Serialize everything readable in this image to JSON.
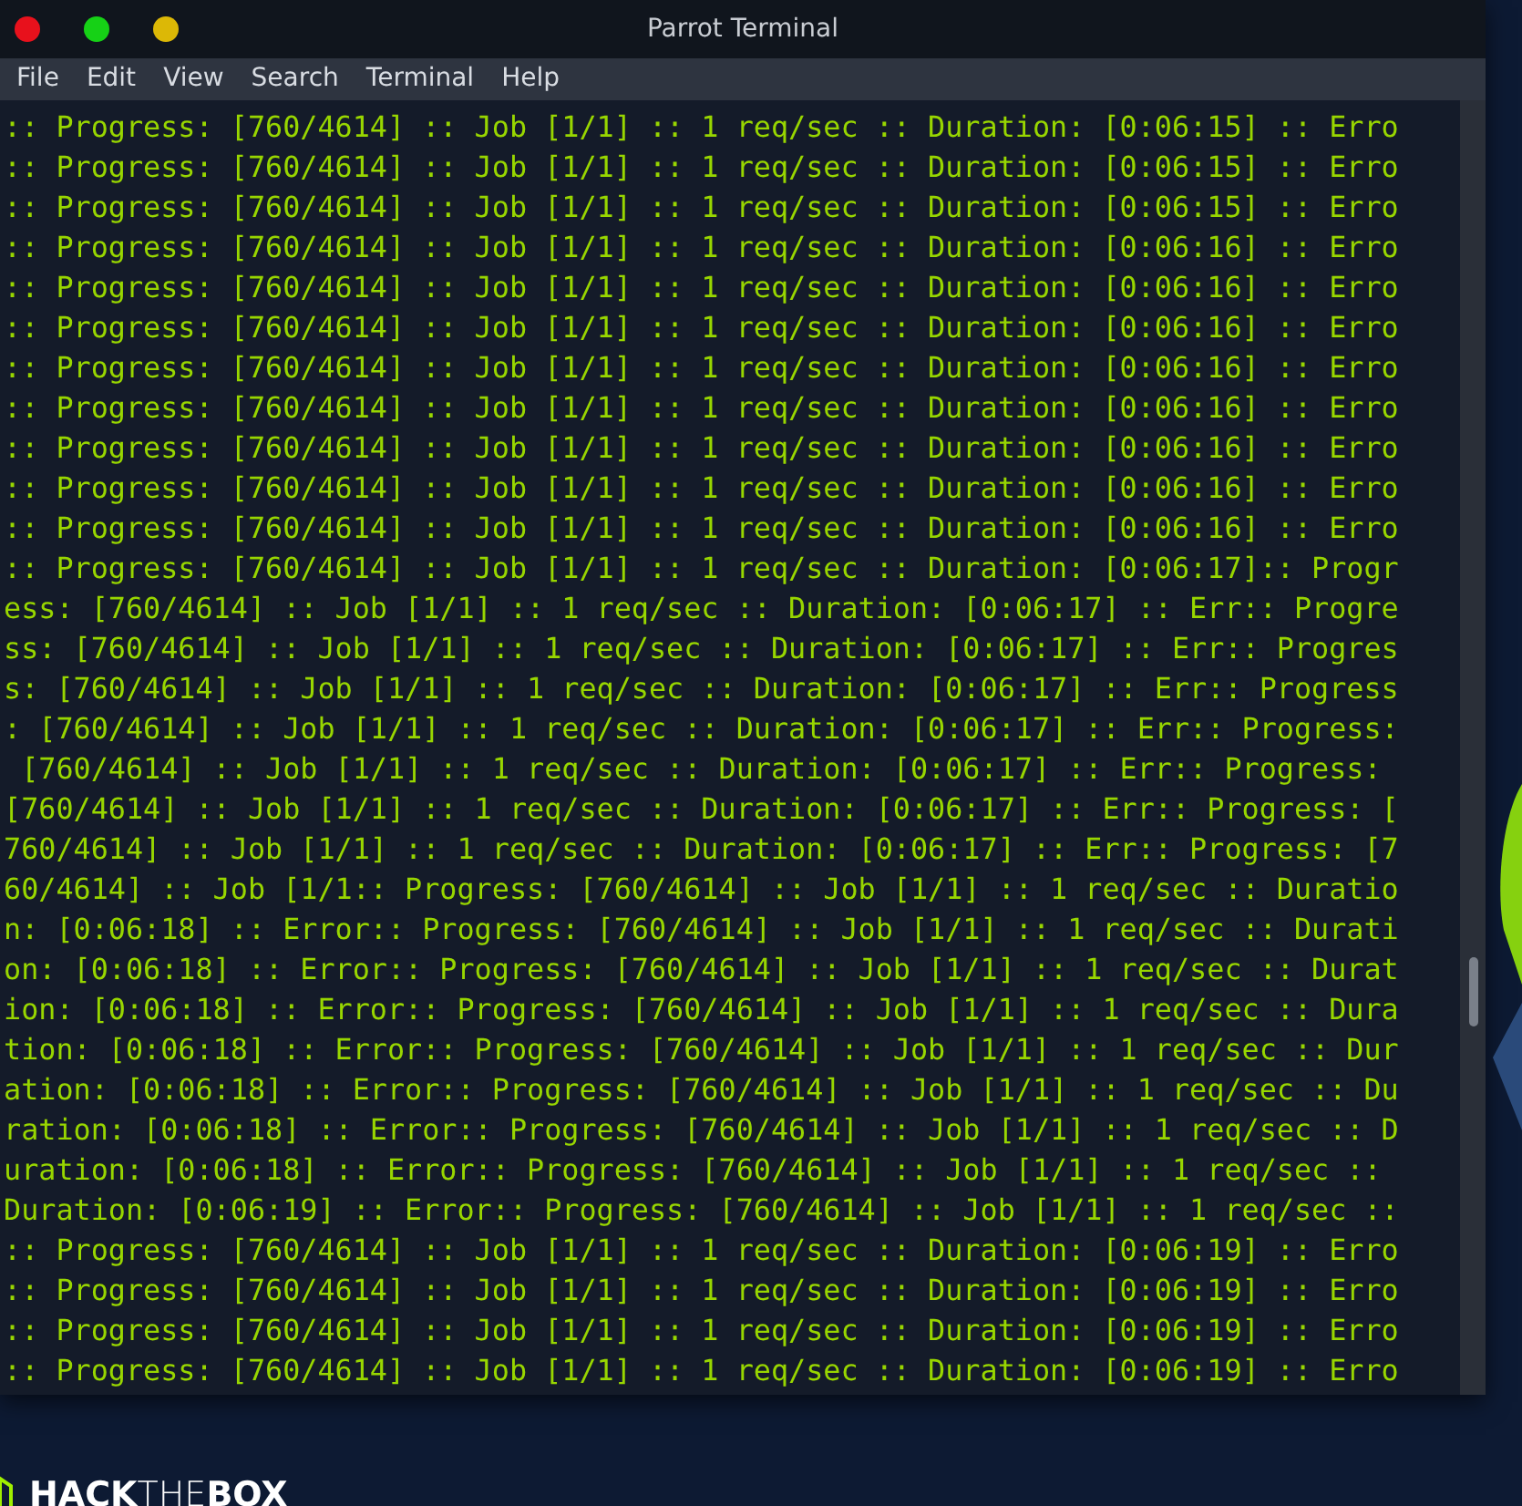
{
  "window": {
    "title": "Parrot Terminal"
  },
  "menu": [
    "File",
    "Edit",
    "View",
    "Search",
    "Terminal",
    "Help"
  ],
  "lines": [
    ":: Progress: [760/4614] :: Job [1/1] :: 1 req/sec :: Duration: [0:06:15] :: Erro",
    ":: Progress: [760/4614] :: Job [1/1] :: 1 req/sec :: Duration: [0:06:15] :: Erro",
    ":: Progress: [760/4614] :: Job [1/1] :: 1 req/sec :: Duration: [0:06:15] :: Erro",
    ":: Progress: [760/4614] :: Job [1/1] :: 1 req/sec :: Duration: [0:06:16] :: Erro",
    ":: Progress: [760/4614] :: Job [1/1] :: 1 req/sec :: Duration: [0:06:16] :: Erro",
    ":: Progress: [760/4614] :: Job [1/1] :: 1 req/sec :: Duration: [0:06:16] :: Erro",
    ":: Progress: [760/4614] :: Job [1/1] :: 1 req/sec :: Duration: [0:06:16] :: Erro",
    ":: Progress: [760/4614] :: Job [1/1] :: 1 req/sec :: Duration: [0:06:16] :: Erro",
    ":: Progress: [760/4614] :: Job [1/1] :: 1 req/sec :: Duration: [0:06:16] :: Erro",
    ":: Progress: [760/4614] :: Job [1/1] :: 1 req/sec :: Duration: [0:06:16] :: Erro",
    ":: Progress: [760/4614] :: Job [1/1] :: 1 req/sec :: Duration: [0:06:16] :: Erro",
    ":: Progress: [760/4614] :: Job [1/1] :: 1 req/sec :: Duration: [0:06:17]:: Progr",
    "ess: [760/4614] :: Job [1/1] :: 1 req/sec :: Duration: [0:06:17] :: Err:: Progre",
    "ss: [760/4614] :: Job [1/1] :: 1 req/sec :: Duration: [0:06:17] :: Err:: Progres",
    "s: [760/4614] :: Job [1/1] :: 1 req/sec :: Duration: [0:06:17] :: Err:: Progress",
    ": [760/4614] :: Job [1/1] :: 1 req/sec :: Duration: [0:06:17] :: Err:: Progress:",
    " [760/4614] :: Job [1/1] :: 1 req/sec :: Duration: [0:06:17] :: Err:: Progress:",
    "[760/4614] :: Job [1/1] :: 1 req/sec :: Duration: [0:06:17] :: Err:: Progress: [",
    "760/4614] :: Job [1/1] :: 1 req/sec :: Duration: [0:06:17] :: Err:: Progress: [7",
    "60/4614] :: Job [1/1:: Progress: [760/4614] :: Job [1/1] :: 1 req/sec :: Duratio",
    "n: [0:06:18] :: Error:: Progress: [760/4614] :: Job [1/1] :: 1 req/sec :: Durati",
    "on: [0:06:18] :: Error:: Progress: [760/4614] :: Job [1/1] :: 1 req/sec :: Durat",
    "ion: [0:06:18] :: Error:: Progress: [760/4614] :: Job [1/1] :: 1 req/sec :: Dura",
    "tion: [0:06:18] :: Error:: Progress: [760/4614] :: Job [1/1] :: 1 req/sec :: Dur",
    "ation: [0:06:18] :: Error:: Progress: [760/4614] :: Job [1/1] :: 1 req/sec :: Du",
    "ration: [0:06:18] :: Error:: Progress: [760/4614] :: Job [1/1] :: 1 req/sec :: D",
    "uration: [0:06:18] :: Error:: Progress: [760/4614] :: Job [1/1] :: 1 req/sec ::",
    "Duration: [0:06:19] :: Error:: Progress: [760/4614] :: Job [1/1] :: 1 req/sec ::",
    ":: Progress: [760/4614] :: Job [1/1] :: 1 req/sec :: Duration: [0:06:19] :: Erro",
    ":: Progress: [760/4614] :: Job [1/1] :: 1 req/sec :: Duration: [0:06:19] :: Erro",
    ":: Progress: [760/4614] :: Job [1/1] :: 1 req/sec :: Duration: [0:06:19] :: Erro",
    ":: Progress: [760/4614] :: Job [1/1] :: 1 req/sec :: Duration: [0:06:19] :: Erro"
  ],
  "logo": {
    "text": "**HACK**THE**BOX**"
  }
}
